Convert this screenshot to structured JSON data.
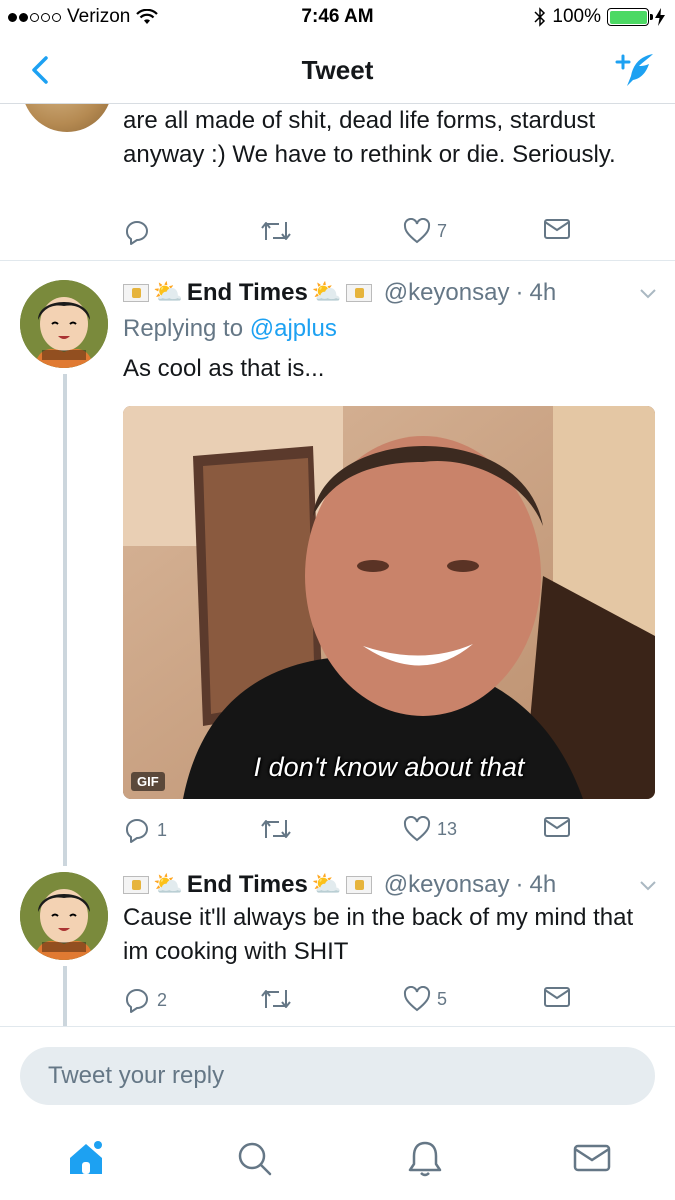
{
  "status_bar": {
    "carrier": "Verizon",
    "time": "7:46 AM",
    "battery": "100%",
    "battery_level": 1.0
  },
  "nav": {
    "title": "Tweet",
    "back_icon": "chevron-left-icon",
    "compose_icon": "compose-feather-icon"
  },
  "previous_tweet": {
    "text": "are all made of shit, dead life forms, stardust anyway :) We have to rethink or die. Seriously.",
    "likes": "7"
  },
  "tweets": [
    {
      "name": "End Times",
      "handle": "@keyonsay",
      "separator": "·",
      "time": "4h",
      "replying_prefix": "Replying to ",
      "replying_handle": "@ajplus",
      "text": "As cool as that is...",
      "media": {
        "badge": "GIF",
        "caption": "I don't know about that"
      },
      "replies": "1",
      "likes": "13"
    },
    {
      "name": "End Times",
      "handle": "@keyonsay",
      "separator": "·",
      "time": "4h",
      "text": "Cause it'll always be in the back of my mind that im cooking with SHIT",
      "replies": "2",
      "likes": "5"
    }
  ],
  "reply_bar": {
    "placeholder": "Tweet your reply"
  },
  "tab_bar": {
    "items": [
      "home-icon",
      "search-icon",
      "notifications-icon",
      "messages-icon"
    ]
  },
  "colors": {
    "accent": "#1da1f2",
    "text": "#14171a",
    "muted": "#657786",
    "battery": "#4cd964"
  }
}
